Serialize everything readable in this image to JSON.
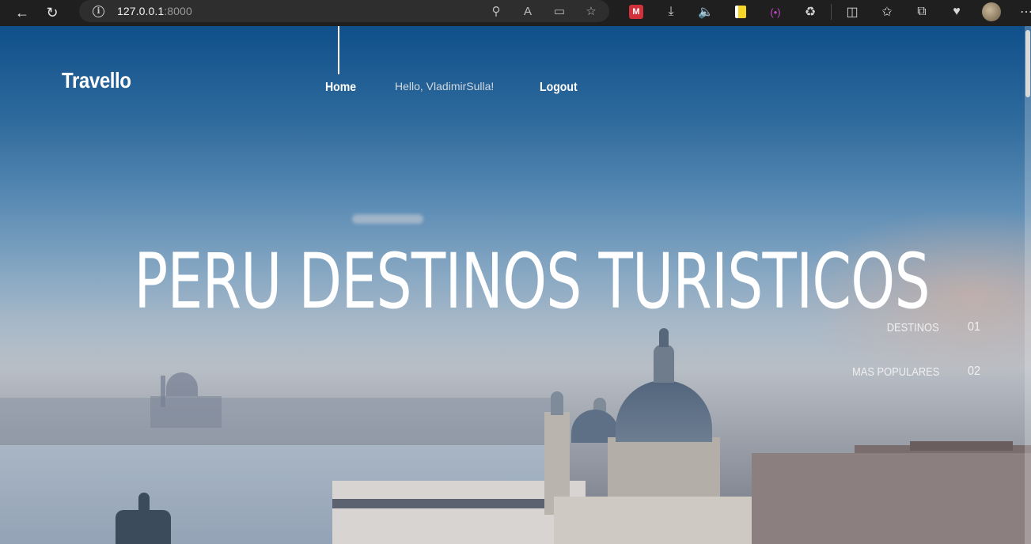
{
  "browser": {
    "url_host": "127.0.0.1",
    "url_port": ":8000",
    "toolbar_icons": [
      "back-icon",
      "reload-icon",
      "info-icon",
      "password-key-icon",
      "read-aloud-icon",
      "reader-view-icon",
      "favorite-star-icon"
    ],
    "extension_icons": [
      "mega-extension-icon",
      "download-icon",
      "volume-icon",
      "yellow-extension-icon",
      "purple-extension-icon",
      "extensions-puzzle-icon",
      "split-screen-icon",
      "favorites-icon",
      "collections-icon",
      "health-icon",
      "profile-avatar",
      "more-menu-icon"
    ]
  },
  "site": {
    "brand": "Travello",
    "nav": {
      "home": "Home",
      "greeting": "Hello, VladimirSulla!",
      "logout": "Logout"
    }
  },
  "hero": {
    "title": "PERU DESTINOS TURISTICOS",
    "slides": [
      {
        "label": "DESTINOS",
        "number": "01"
      },
      {
        "label": "MAS POPULARES",
        "number": "02"
      }
    ]
  },
  "colors": {
    "chrome_bg": "#1f1f1f",
    "address_bg": "#2e2e2e",
    "sky_top": "#0f4f8a",
    "text": "#ffffff"
  }
}
